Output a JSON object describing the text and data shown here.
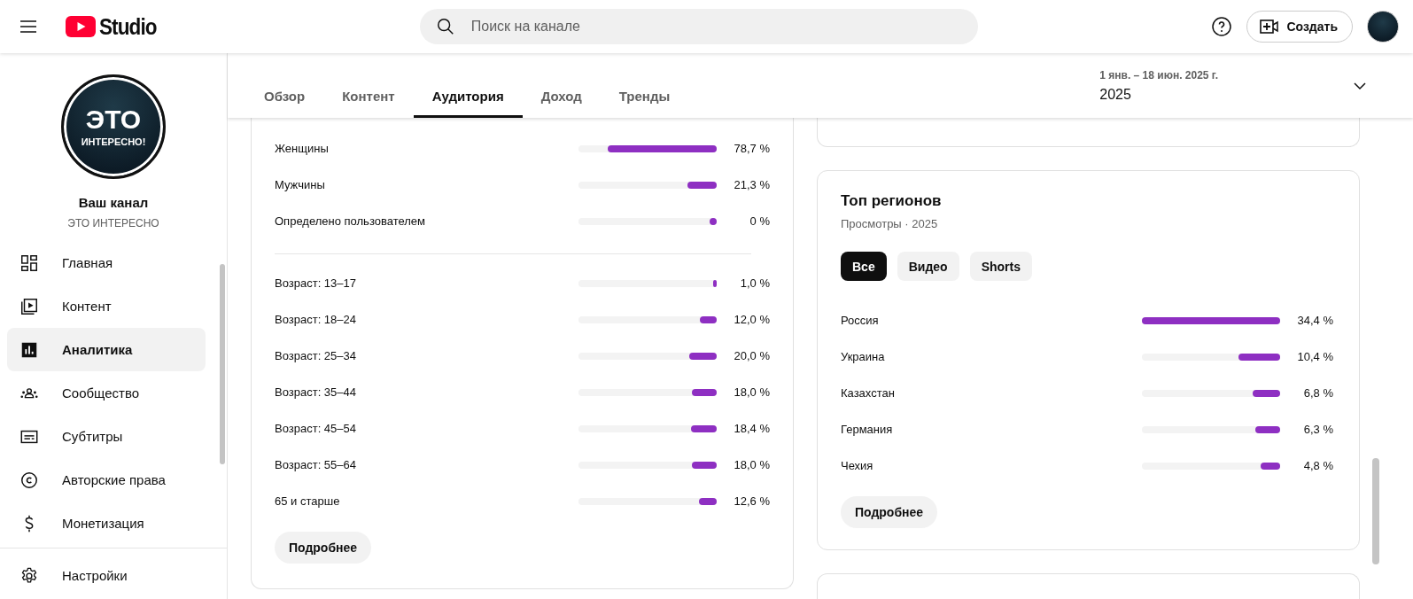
{
  "header": {
    "logo_text": "Studio",
    "search": {
      "placeholder": "Поиск на канале"
    },
    "create_button": "Создать"
  },
  "sidebar": {
    "channel_title": "Ваш канал",
    "channel_name": "ЭТО ИНТЕРЕСНО",
    "avatar_text": [
      "ЭТО",
      "ИНТЕРЕСНО!"
    ],
    "items": [
      {
        "label": "Главная",
        "selected": false
      },
      {
        "label": "Контент",
        "selected": false
      },
      {
        "label": "Аналитика",
        "selected": true
      },
      {
        "label": "Сообщество",
        "selected": false
      },
      {
        "label": "Субтитры",
        "selected": false
      },
      {
        "label": "Авторские права",
        "selected": false
      },
      {
        "label": "Монетизация",
        "selected": false
      }
    ],
    "settings": {
      "label": "Настройки"
    }
  },
  "tabs": [
    {
      "label": "Обзор",
      "selected": false
    },
    {
      "label": "Контент",
      "selected": false
    },
    {
      "label": "Аудитория",
      "selected": true
    },
    {
      "label": "Доход",
      "selected": false
    },
    {
      "label": "Тренды",
      "selected": false
    }
  ],
  "date_range": {
    "range": "1 янв. – 18 июн. 2025 г.",
    "value": "2025"
  },
  "demographics": {
    "gender": [
      {
        "label": "Женщины",
        "level": 0.787,
        "value": "78,7 %"
      },
      {
        "label": "Мужчины",
        "level": 0.213,
        "value": "21,3 %"
      },
      {
        "label": "Определено пользователем",
        "level": 0,
        "value": "0 %"
      }
    ],
    "age": [
      {
        "label": "Возраст: 13–17",
        "level": 0.01,
        "value": "1,0 %"
      },
      {
        "label": "Возраст: 18–24",
        "level": 0.12,
        "value": "12,0 %"
      },
      {
        "label": "Возраст: 25–34",
        "level": 0.2,
        "value": "20,0 %"
      },
      {
        "label": "Возраст: 35–44",
        "level": 0.18,
        "value": "18,0 %"
      },
      {
        "label": "Возраст: 45–54",
        "level": 0.184,
        "value": "18,4 %"
      },
      {
        "label": "Возраст: 55–64",
        "level": 0.18,
        "value": "18,0 %"
      },
      {
        "label": "65 и старше",
        "level": 0.126,
        "value": "12,6 %"
      }
    ],
    "more_button": "Подробнее"
  },
  "top_regions": {
    "title": "Топ регионов",
    "subtitle": "Просмотры · 2025",
    "filters": [
      {
        "label": "Все",
        "selected": true
      },
      {
        "label": "Видео",
        "selected": false
      },
      {
        "label": "Shorts",
        "selected": false
      }
    ],
    "rows": [
      {
        "label": "Россия",
        "level": 1,
        "value": "34,4 %"
      },
      {
        "label": "Украина",
        "level": 0.3,
        "value": "10,4 %"
      },
      {
        "label": "Казахстан",
        "level": 0.2,
        "value": "6,8 %"
      },
      {
        "label": "Германия",
        "level": 0.18,
        "value": "6,3 %"
      },
      {
        "label": "Чехия",
        "level": 0.14,
        "value": "4,8 %"
      }
    ],
    "more_button": "Подробнее"
  }
}
